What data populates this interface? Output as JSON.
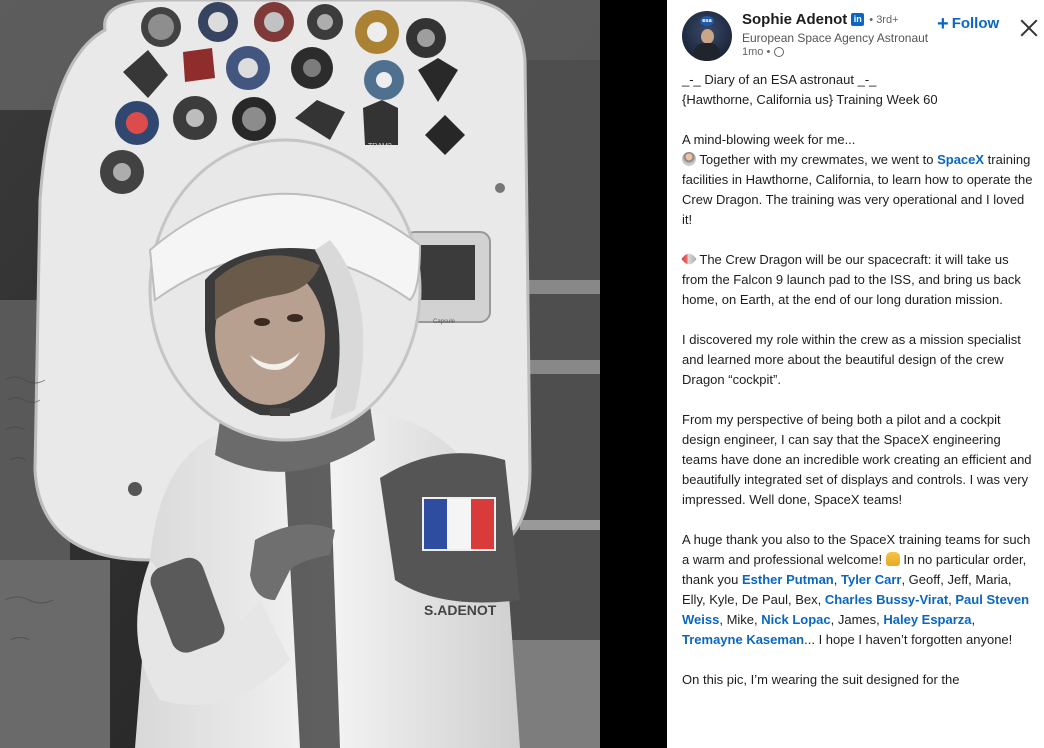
{
  "post": {
    "author_name": "Sophie Adenot",
    "degree": "• 3rd+",
    "headline": "European Space Agency Astronaut",
    "time": "1mo •",
    "follow_label": "Follow",
    "linkedin_badge": "in",
    "avatar_logo_text": "esa"
  },
  "photo": {
    "name_tag": "S.ADENOT",
    "hatch_label": "Capsule",
    "patch_label": "TRAM2"
  },
  "text": {
    "p1_l1": "_-_ Diary of an ESA astronaut _-_",
    "p1_l2": "{Hawthorne, California us} Training Week 60",
    "p2_l1": "A mind-blowing week for me...",
    "p2_a": " Together with my crewmates, we went to ",
    "p2_mention": "SpaceX",
    "p2_b": " training facilities in Hawthorne, California, to learn how to operate the Crew Dragon. The training was very operational and I loved it!",
    "p3": " The Crew Dragon will be our spacecraft: it will take us from the Falcon 9 launch pad to the ISS, and bring us back home, on Earth, at the end of our long duration mission.",
    "p4": "I discovered my role within the crew as a mission specialist and learned more about the beautiful design of the crew Dragon “cockpit”.",
    "p5": "From my perspective of being both a pilot and a cockpit design engineer, I can say that the SpaceX engineering teams have done an incredible work creating an efficient and beautifully integrated set of displays and controls. I was very impressed. Well done, SpaceX teams!",
    "p6_a": "A huge thank you also to the SpaceX training teams for such a warm and professional welcome! ",
    "p6_b": " In no particular order, thank you ",
    "m1": "Esther Putman",
    "sep1": ", ",
    "m2": "Tyler Carr",
    "p6_c": ", Geoff, Jeff, Maria, Elly, Kyle, De Paul, Bex, ",
    "m3": "Charles Bussy-Virat",
    "sep2": ", ",
    "m4": "Paul Steven Weiss",
    "p6_d": ", Mike, ",
    "m5": "Nick Lopac",
    "p6_e": ", James, ",
    "m6": "Haley Esparza",
    "sep3": ", ",
    "m7": "Tremayne Kaseman",
    "p6_f": "... I hope I haven’t forgotten anyone!",
    "p7": "On this pic, I’m wearing the suit designed for the"
  }
}
